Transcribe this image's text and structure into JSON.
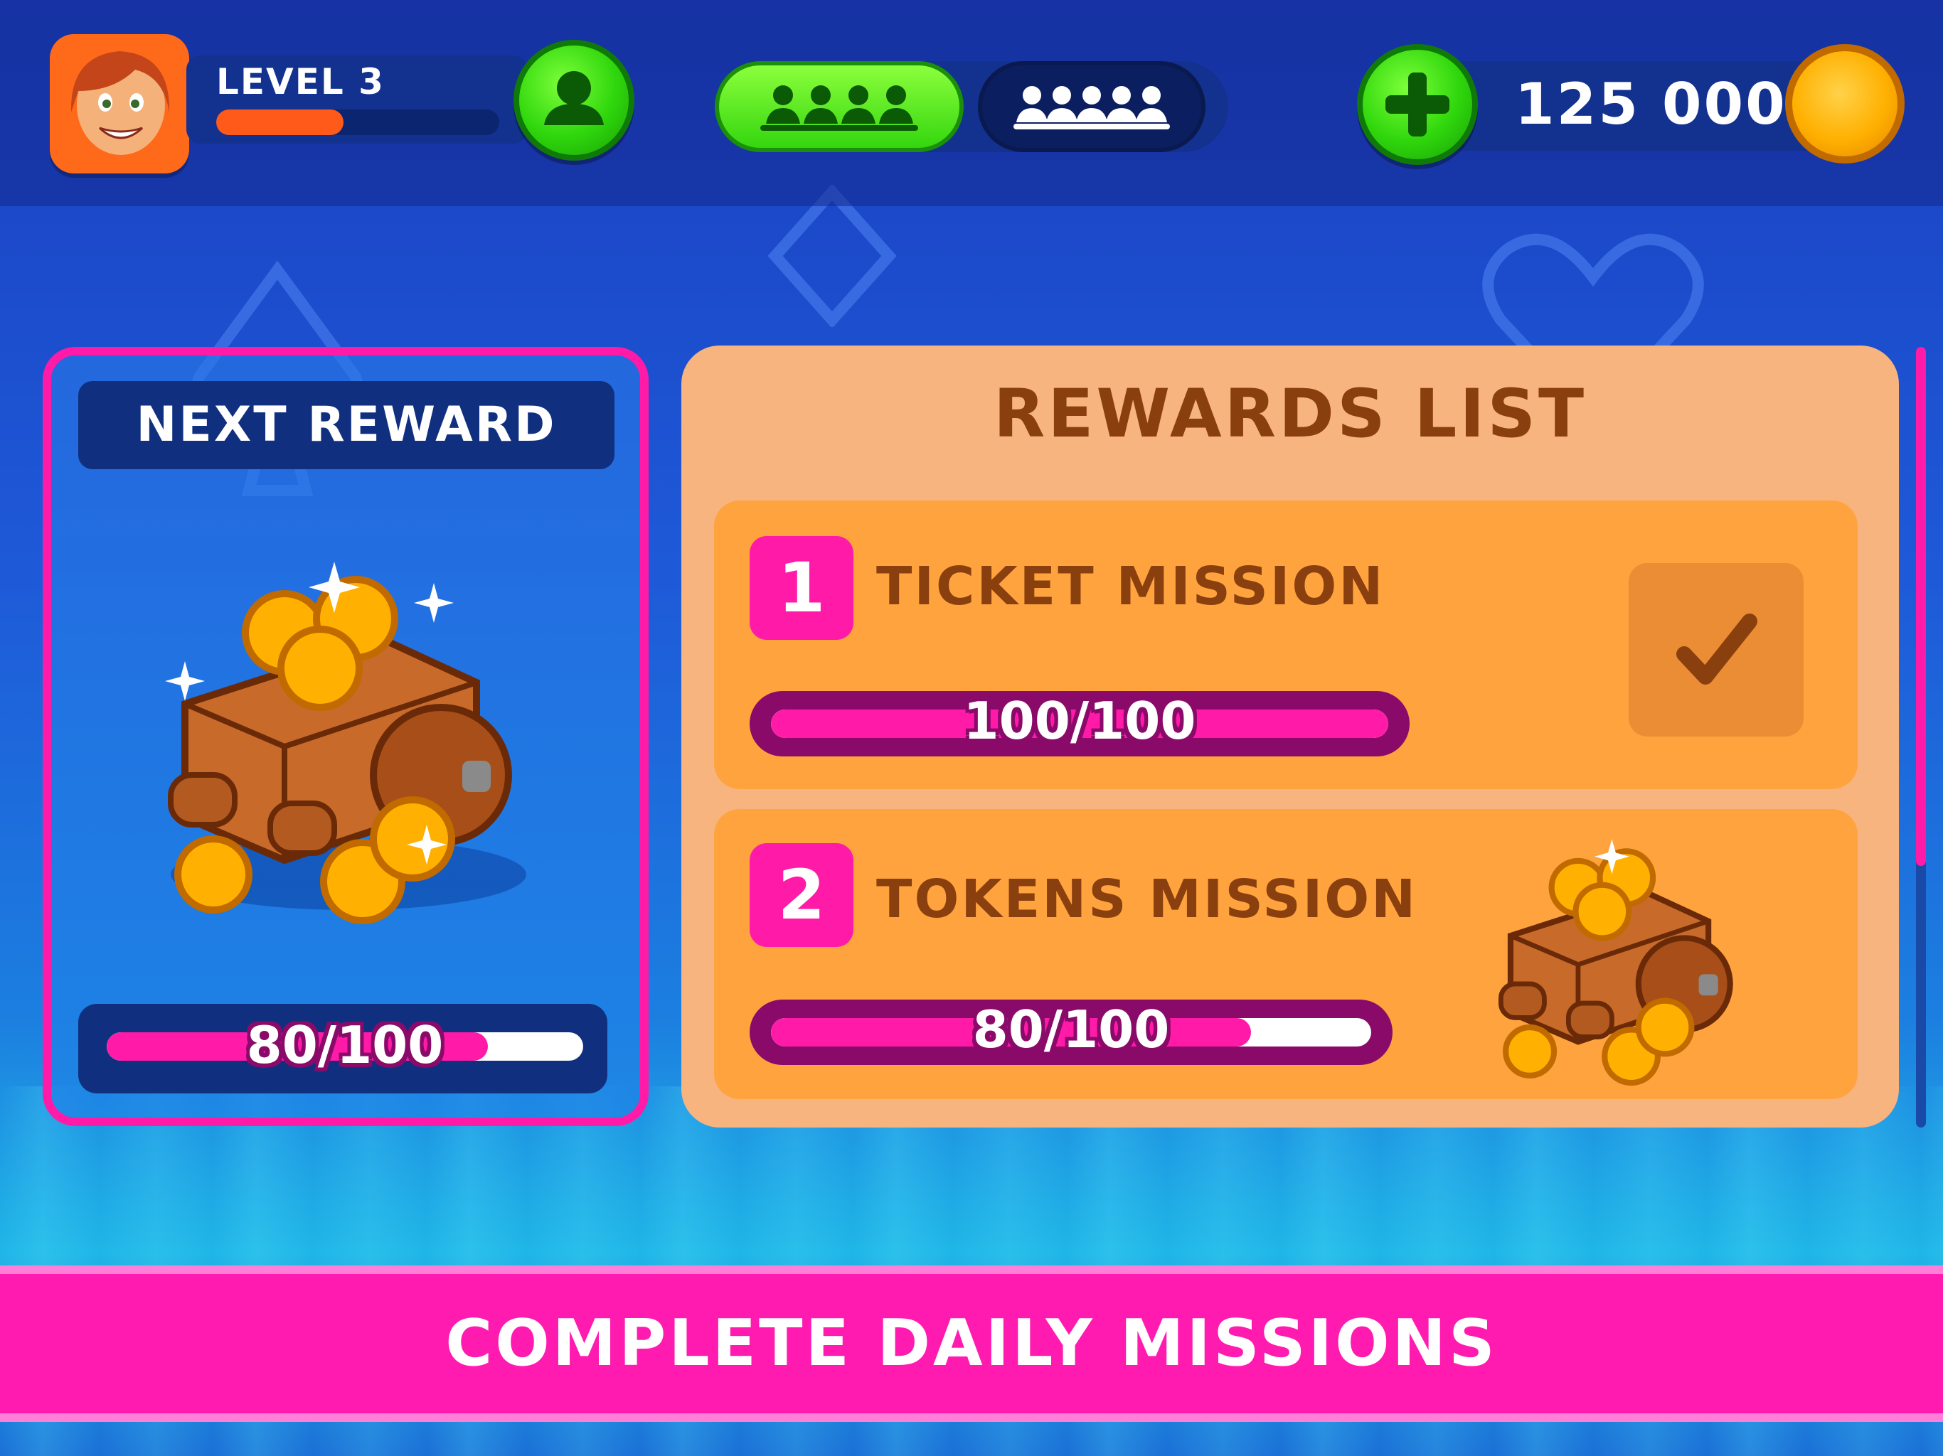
{
  "header": {
    "level_label": "LEVEL 3",
    "xp_progress": 0.45,
    "coin_amount": "125 000"
  },
  "next_reward": {
    "title": "NEXT REWARD",
    "progress_text": "80/100",
    "progress": 0.8
  },
  "rewards_list": {
    "title": "REWARDS LIST",
    "missions": [
      {
        "number": "1",
        "title": "TICKET MISSION",
        "progress_text": "100/100",
        "progress": 1.0,
        "completed": true
      },
      {
        "number": "2",
        "title": "TOKENS MISSION",
        "progress_text": "80/100",
        "progress": 0.8,
        "completed": false
      }
    ]
  },
  "banner": {
    "text": "COMPLETE DAILY MISSIONS"
  },
  "colors": {
    "accent_pink": "#ff1aa8",
    "accent_green": "#34d60f",
    "card_orange": "#ffa33f",
    "text_brown": "#8a3f0e"
  },
  "icons": [
    "avatar",
    "profile-icon",
    "team-icon",
    "group-icon",
    "plus-icon",
    "coin-icon",
    "reward-cart-icon",
    "check-icon"
  ]
}
